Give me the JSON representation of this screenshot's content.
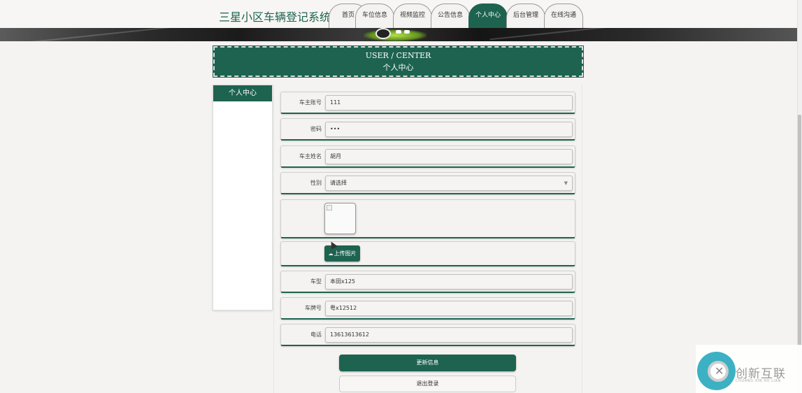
{
  "header": {
    "site_title": "三星小区车辆登记系统",
    "nav": [
      {
        "label": "首页",
        "active": false
      },
      {
        "label": "车位信息",
        "active": false
      },
      {
        "label": "视频监控",
        "active": false
      },
      {
        "label": "公告信息",
        "active": false
      },
      {
        "label": "个人中心",
        "active": true
      },
      {
        "label": "后台管理",
        "active": false
      },
      {
        "label": "在线沟通",
        "active": false
      }
    ]
  },
  "banner": {
    "carousel_dots": 2
  },
  "page_heading": {
    "en": "USER / CENTER",
    "cn": "个人中心"
  },
  "sidebar": {
    "title": "个人中心"
  },
  "form": {
    "account": {
      "label": "车主账号",
      "value": "111"
    },
    "password": {
      "label": "密码",
      "value": "•••"
    },
    "owner_name": {
      "label": "车主姓名",
      "value": "胡月"
    },
    "gender": {
      "label": "性别",
      "value": "请选择"
    },
    "upload_label": "上传图片",
    "car_model": {
      "label": "车型",
      "value": "本田x125"
    },
    "plate_number": {
      "label": "车牌号",
      "value": "粤x12512"
    },
    "phone": {
      "label": "电话",
      "value": "13613613612"
    }
  },
  "actions": {
    "update": "更新信息",
    "logout": "退出登录"
  },
  "watermark": {
    "text": "创新互联",
    "sub": "CHUANG XIN HU LIAN"
  },
  "colors": {
    "primary": "#1d6350",
    "background": "#f4f3f1"
  }
}
